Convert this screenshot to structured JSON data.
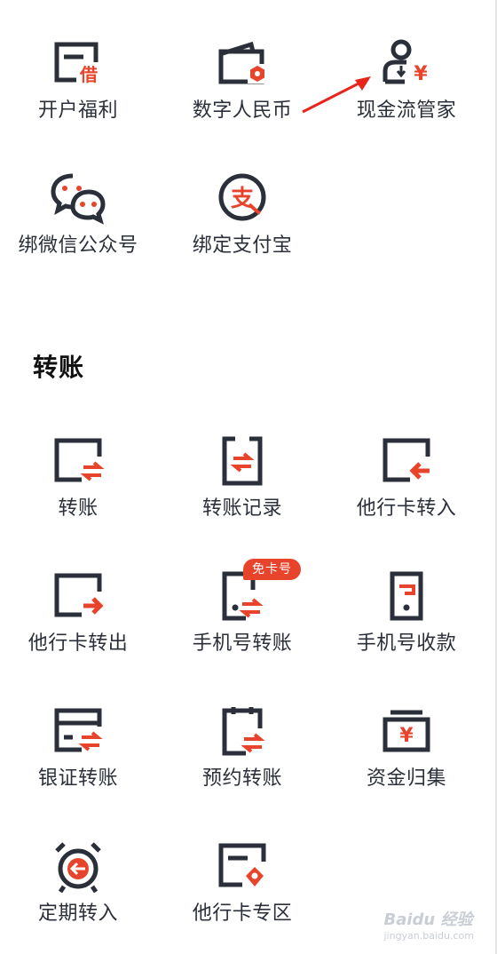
{
  "services": {
    "items": [
      {
        "label": "开户福利",
        "icon": "account-welfare-icon"
      },
      {
        "label": "数字人民币",
        "icon": "digital-rmb-wallet-icon"
      },
      {
        "label": "现金流管家",
        "icon": "cashflow-manager-icon"
      },
      {
        "label": "绑微信公众号",
        "icon": "wechat-icon"
      },
      {
        "label": "绑定支付宝",
        "icon": "alipay-icon"
      }
    ]
  },
  "transfer": {
    "title": "转账",
    "items": [
      {
        "label": "转账",
        "icon": "transfer-icon"
      },
      {
        "label": "转账记录",
        "icon": "transfer-record-icon"
      },
      {
        "label": "他行卡转入",
        "icon": "other-bank-in-icon"
      },
      {
        "label": "他行卡转出",
        "icon": "other-bank-out-icon"
      },
      {
        "label": "手机号转账",
        "icon": "phone-transfer-icon",
        "badge": "免卡号"
      },
      {
        "label": "手机号收款",
        "icon": "phone-receive-icon"
      },
      {
        "label": "银证转账",
        "icon": "bank-securities-icon"
      },
      {
        "label": "预约转账",
        "icon": "scheduled-transfer-icon"
      },
      {
        "label": "资金归集",
        "icon": "fund-collection-icon"
      },
      {
        "label": "定期转入",
        "icon": "alarm-clock-icon"
      },
      {
        "label": "他行卡专区",
        "icon": "other-bank-zone-icon"
      }
    ]
  },
  "watermark": {
    "brand": "Baidu 经验",
    "url": "jingyan.baidu.com"
  },
  "colors": {
    "dark": "#2a2f3a",
    "accent": "#e8442b"
  }
}
